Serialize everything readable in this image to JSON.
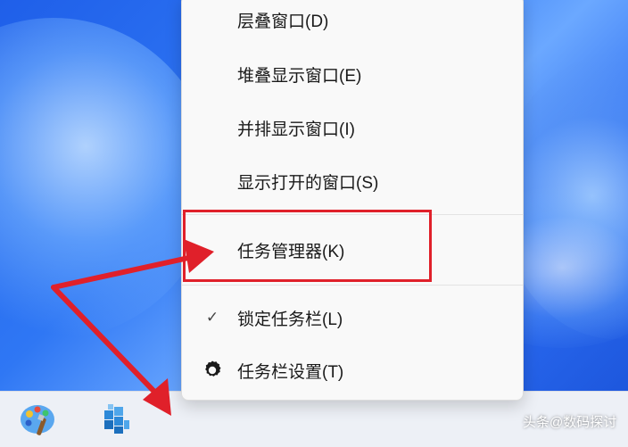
{
  "context_menu": {
    "items": [
      {
        "label": "层叠窗口(D)"
      },
      {
        "label": "堆叠显示窗口(E)"
      },
      {
        "label": "并排显示窗口(I)"
      },
      {
        "label": "显示打开的窗口(S)"
      },
      {
        "label": "任务管理器(K)"
      },
      {
        "label": "锁定任务栏(L)",
        "checkmark": "✓"
      },
      {
        "label": "任务栏设置(T)",
        "icon": "gear-icon"
      }
    ]
  },
  "annotation": {
    "highlight_color": "#e0202a"
  },
  "taskbar": {
    "icons": [
      "paint-palette-icon",
      "cube-app-icon"
    ]
  },
  "watermark": {
    "text": "头条@数码探讨"
  }
}
